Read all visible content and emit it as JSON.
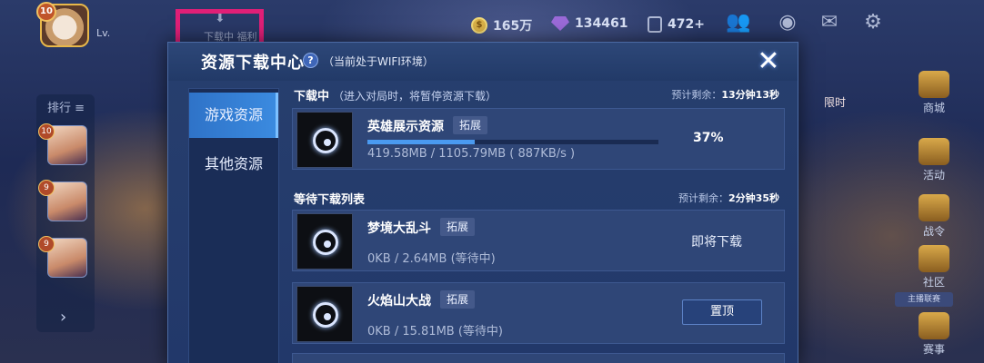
{
  "background": {
    "top_tab_label": "下载中 福利",
    "player_level_text": "Lv.",
    "level_badge": "10",
    "gold": "165万",
    "diamonds": "134461",
    "tickets": "472+",
    "rank_title": "排行 ≡",
    "rank_entries": [
      "10",
      "9",
      "9"
    ],
    "right_menu": [
      "商城",
      "活动",
      "战令",
      "社区",
      "赛事"
    ],
    "community_flag": "主播联赛",
    "timeline_label": "限时"
  },
  "modal": {
    "title": "资源下载中心",
    "help_icon": "?",
    "wifi_note": "（当前处于WIFI环境）",
    "close_icon": "✕",
    "tabs": [
      {
        "label": "游戏资源",
        "active": true
      },
      {
        "label": "其他资源",
        "active": false
      }
    ],
    "downloading": {
      "title": "下载中",
      "subtitle": "（进入对局时，将暂停资源下载）",
      "remaining_label": "预计剩余：",
      "remaining_value": "13分钟13秒",
      "item": {
        "name": "英雄展示资源",
        "badge": "拓展",
        "size": "419.58MB / 1105.79MB ( 887KB/s )",
        "percent_text": "37%",
        "progress": 0.37
      }
    },
    "queue": {
      "title": "等待下载列表",
      "remaining_label": "预计剩余：",
      "remaining_value": "2分钟35秒",
      "items": [
        {
          "name": "梦境大乱斗",
          "badge": "拓展",
          "size": "0KB / 2.64MB (等待中)",
          "action": "即将下载"
        },
        {
          "name": "火焰山大战",
          "badge": "拓展",
          "size": "0KB / 15.81MB (等待中)",
          "action": "置顶"
        }
      ]
    }
  }
}
